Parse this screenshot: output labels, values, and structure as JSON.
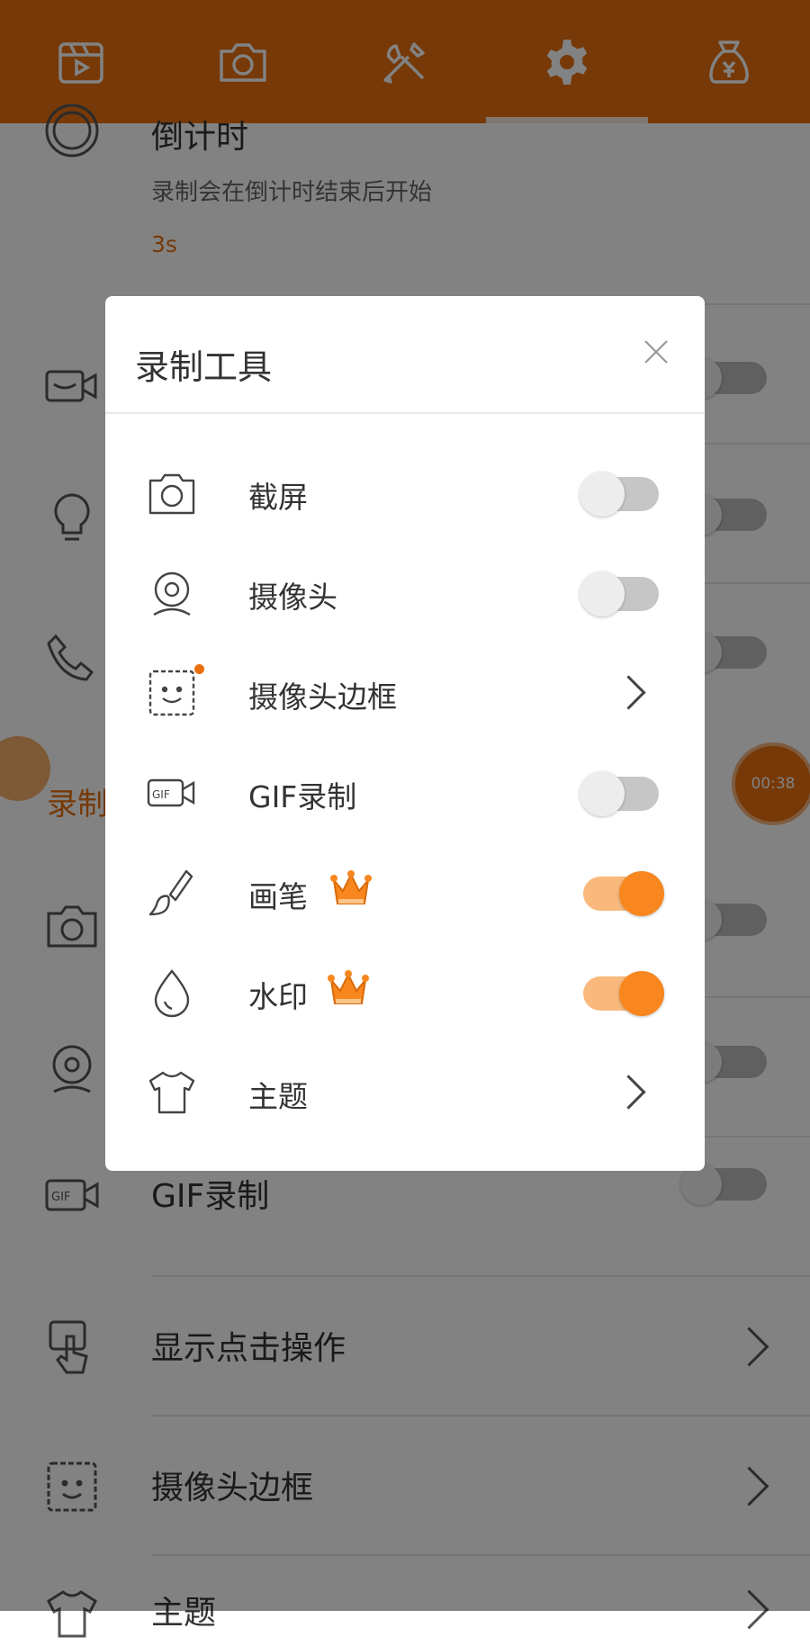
{
  "colors": {
    "accent": "#e8700f",
    "toggle_on": "#f7871e",
    "toggle_on_track": "#f9b97c",
    "toggle_off_track": "#c6c6c6"
  },
  "tabs": [
    {
      "icon": "video-icon"
    },
    {
      "icon": "camera-icon"
    },
    {
      "icon": "tools-icon"
    },
    {
      "icon": "gear-icon",
      "active": true
    },
    {
      "icon": "money-bag-icon"
    }
  ],
  "background": {
    "countdown": {
      "title": "倒计时",
      "subtitle": "录制会在倒计时结束后开始",
      "value": "3s"
    },
    "section_label": "录制",
    "timer_bubble": "00:38",
    "rows": {
      "gif": "GIF录制",
      "show_taps": "显示点击操作",
      "camera_border": "摄像头边框",
      "theme": "主题"
    }
  },
  "dialog": {
    "title": "录制工具",
    "items": [
      {
        "label": "截屏",
        "icon": "camera-icon",
        "control": "toggle",
        "on": false
      },
      {
        "label": "摄像头",
        "icon": "webcam-icon",
        "control": "toggle",
        "on": false
      },
      {
        "label": "摄像头边框",
        "icon": "camera-border-icon",
        "control": "chevron",
        "badge_dot": true
      },
      {
        "label": "GIF录制",
        "icon": "gif-icon",
        "control": "toggle",
        "on": false
      },
      {
        "label": "画笔",
        "icon": "brush-icon",
        "control": "toggle",
        "on": true,
        "premium": true
      },
      {
        "label": "水印",
        "icon": "watermark-drop-icon",
        "control": "toggle",
        "on": true,
        "premium": true
      },
      {
        "label": "主题",
        "icon": "tshirt-icon",
        "control": "chevron"
      }
    ]
  }
}
